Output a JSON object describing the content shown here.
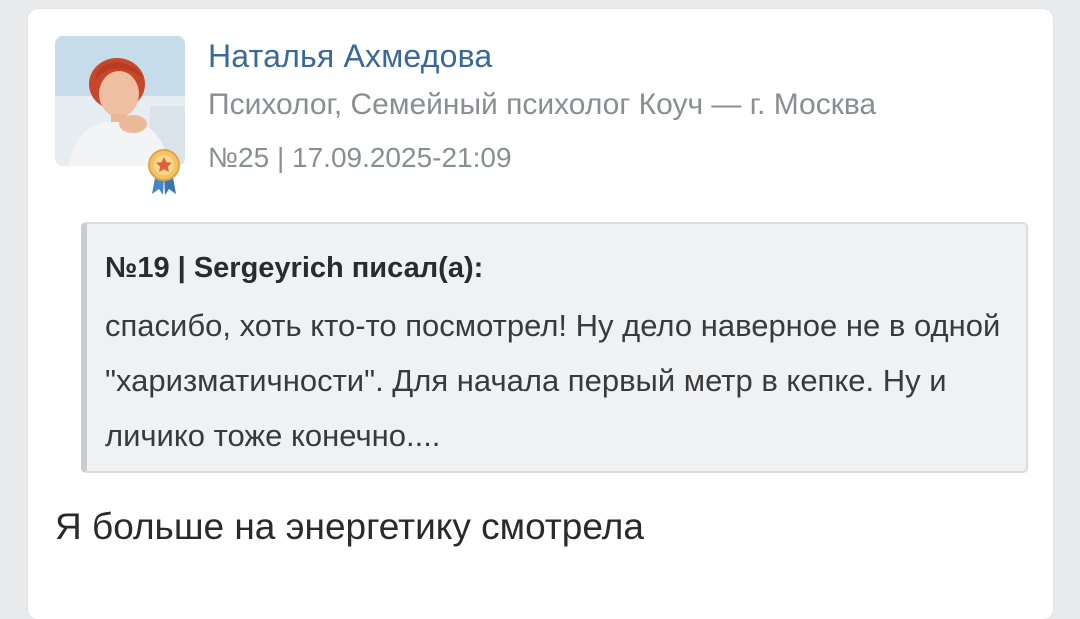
{
  "post": {
    "author_name": "Наталья Ахмедова",
    "author_role": "Психолог, Семейный психолог Коуч — г. Москва",
    "meta": "№25 | 17.09.2025-21:09",
    "avatar_icon": "author-photo",
    "badge_icon": "award-ribbon-icon",
    "quote": {
      "header": "№19 | Sergeyrich писал(а):",
      "text": "спасибо, хоть кто-то посмотрел! Ну дело наверное не в одной \"харизматичности\". Для начала первый метр в кепке. Ну и личико тоже конечно...."
    },
    "reply": "Я больше на энергетику смотрела"
  },
  "colors": {
    "author_link": "#3a6897",
    "muted": "#8a8d92",
    "quote_bg": "#f0f1f3",
    "badge_gold": "#e8b04a",
    "badge_ribbon": "#4a86c5"
  }
}
